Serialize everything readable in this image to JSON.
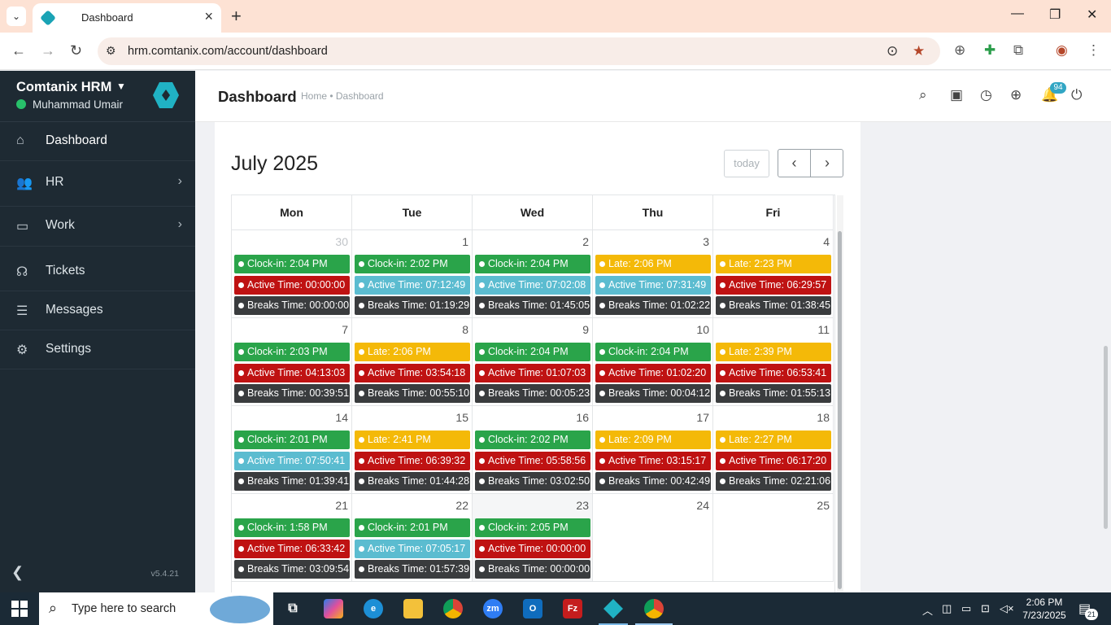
{
  "browser": {
    "tab_title": "Dashboard",
    "url": "hrm.comtanix.com/account/dashboard"
  },
  "sidebar": {
    "brand": "Comtanix HRM",
    "user": "Muhammad Umair",
    "items": [
      {
        "label": "Dashboard",
        "icon": "home-icon"
      },
      {
        "label": "HR",
        "icon": "users-icon"
      },
      {
        "label": "Work",
        "icon": "briefcase-icon"
      },
      {
        "label": "Tickets",
        "icon": "headset-icon"
      },
      {
        "label": "Messages",
        "icon": "message-icon"
      },
      {
        "label": "Settings",
        "icon": "gear-icon"
      }
    ],
    "version": "v5.4.21"
  },
  "header": {
    "title": "Dashboard",
    "breadcrumb": "Home • Dashboard",
    "notification_count": "94"
  },
  "calendar": {
    "month": "July 2025",
    "today_label": "today",
    "days": [
      "Mon",
      "Tue",
      "Wed",
      "Thu",
      "Fri"
    ],
    "weeks": [
      [
        {
          "day": "30",
          "other": true,
          "events": [
            [
              "Clock-in: 2:04 PM",
              "green"
            ],
            [
              "Active Time: 00:00:00",
              "red"
            ],
            [
              "Breaks Time: 00:00:00",
              "dark"
            ]
          ]
        },
        {
          "day": "1",
          "events": [
            [
              "Clock-in: 2:02 PM",
              "green"
            ],
            [
              "Active Time: 07:12:49",
              "teal"
            ],
            [
              "Breaks Time: 01:19:29",
              "dark"
            ]
          ]
        },
        {
          "day": "2",
          "events": [
            [
              "Clock-in: 2:04 PM",
              "green"
            ],
            [
              "Active Time: 07:02:08",
              "teal"
            ],
            [
              "Breaks Time: 01:45:05",
              "dark"
            ]
          ]
        },
        {
          "day": "3",
          "events": [
            [
              "Late: 2:06 PM",
              "yellow"
            ],
            [
              "Active Time: 07:31:49",
              "teal"
            ],
            [
              "Breaks Time: 01:02:22",
              "dark"
            ]
          ]
        },
        {
          "day": "4",
          "events": [
            [
              "Late: 2:23 PM",
              "yellow"
            ],
            [
              "Active Time: 06:29:57",
              "red"
            ],
            [
              "Breaks Time: 01:38:45",
              "dark"
            ]
          ]
        }
      ],
      [
        {
          "day": "7",
          "events": [
            [
              "Clock-in: 2:03 PM",
              "green"
            ],
            [
              "Active Time: 04:13:03",
              "red"
            ],
            [
              "Breaks Time: 00:39:51",
              "dark"
            ]
          ]
        },
        {
          "day": "8",
          "events": [
            [
              "Late: 2:06 PM",
              "yellow"
            ],
            [
              "Active Time: 03:54:18",
              "red"
            ],
            [
              "Breaks Time: 00:55:10",
              "dark"
            ]
          ]
        },
        {
          "day": "9",
          "events": [
            [
              "Clock-in: 2:04 PM",
              "green"
            ],
            [
              "Active Time: 01:07:03",
              "red"
            ],
            [
              "Breaks Time: 00:05:23",
              "dark"
            ]
          ]
        },
        {
          "day": "10",
          "events": [
            [
              "Clock-in: 2:04 PM",
              "green"
            ],
            [
              "Active Time: 01:02:20",
              "red"
            ],
            [
              "Breaks Time: 00:04:12",
              "dark"
            ]
          ]
        },
        {
          "day": "11",
          "events": [
            [
              "Late: 2:39 PM",
              "yellow"
            ],
            [
              "Active Time: 06:53:41",
              "red"
            ],
            [
              "Breaks Time: 01:55:13",
              "dark"
            ]
          ]
        }
      ],
      [
        {
          "day": "14",
          "events": [
            [
              "Clock-in: 2:01 PM",
              "green"
            ],
            [
              "Active Time: 07:50:41",
              "teal"
            ],
            [
              "Breaks Time: 01:39:41",
              "dark"
            ]
          ]
        },
        {
          "day": "15",
          "events": [
            [
              "Late: 2:41 PM",
              "yellow"
            ],
            [
              "Active Time: 06:39:32",
              "red"
            ],
            [
              "Breaks Time: 01:44:28",
              "dark"
            ]
          ]
        },
        {
          "day": "16",
          "events": [
            [
              "Clock-in: 2:02 PM",
              "green"
            ],
            [
              "Active Time: 05:58:56",
              "red"
            ],
            [
              "Breaks Time: 03:02:50",
              "dark"
            ]
          ]
        },
        {
          "day": "17",
          "events": [
            [
              "Late: 2:09 PM",
              "yellow"
            ],
            [
              "Active Time: 03:15:17",
              "red"
            ],
            [
              "Breaks Time: 00:42:49",
              "dark"
            ]
          ]
        },
        {
          "day": "18",
          "events": [
            [
              "Late: 2:27 PM",
              "yellow"
            ],
            [
              "Active Time: 06:17:20",
              "red"
            ],
            [
              "Breaks Time: 02:21:06",
              "dark"
            ]
          ]
        }
      ],
      [
        {
          "day": "21",
          "events": [
            [
              "Clock-in: 1:58 PM",
              "green"
            ],
            [
              "Active Time: 06:33:42",
              "red"
            ],
            [
              "Breaks Time: 03:09:54",
              "dark"
            ]
          ]
        },
        {
          "day": "22",
          "events": [
            [
              "Clock-in: 2:01 PM",
              "green"
            ],
            [
              "Active Time: 07:05:17",
              "teal"
            ],
            [
              "Breaks Time: 01:57:39",
              "dark"
            ]
          ]
        },
        {
          "day": "23",
          "today": true,
          "events": [
            [
              "Clock-in: 2:05 PM",
              "green"
            ],
            [
              "Active Time: 00:00:00",
              "red"
            ],
            [
              "Breaks Time: 00:00:00",
              "dark"
            ]
          ]
        },
        {
          "day": "24",
          "events": []
        },
        {
          "day": "25",
          "events": []
        }
      ]
    ]
  },
  "taskbar": {
    "search_placeholder": "Type here to search",
    "time": "2:06 PM",
    "date": "7/23/2025",
    "notification_count": "21"
  }
}
